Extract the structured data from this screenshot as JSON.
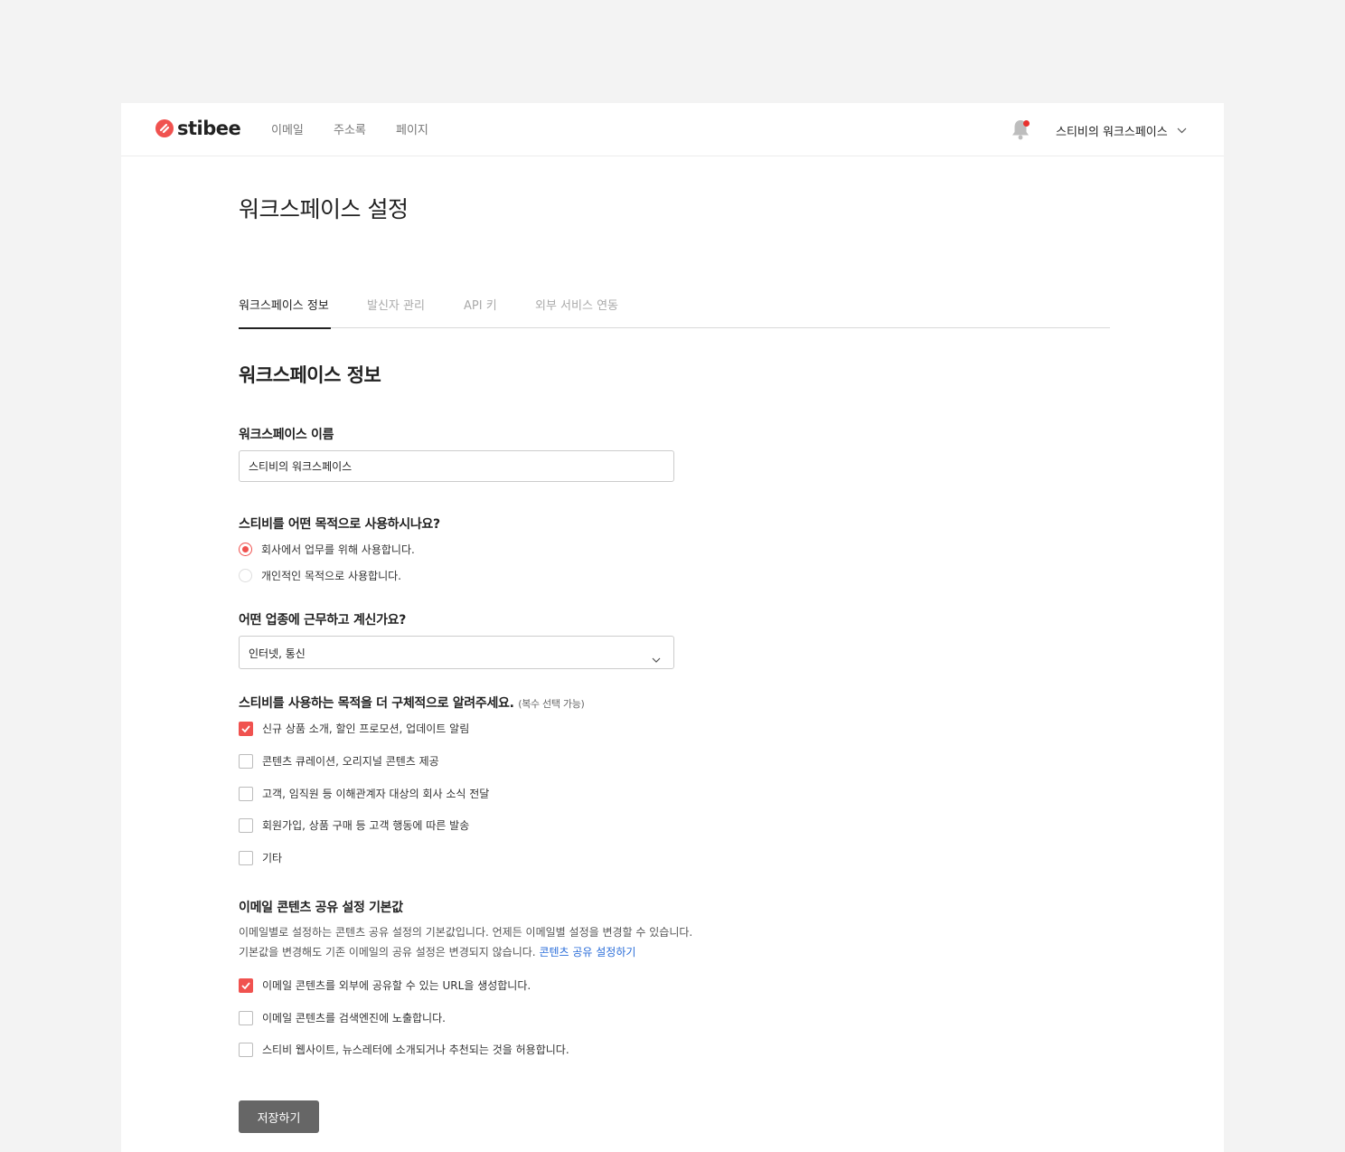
{
  "brand": {
    "name": "stibee",
    "accent": "#f0524f"
  },
  "nav": {
    "items": [
      {
        "label": "이메일"
      },
      {
        "label": "주소록"
      },
      {
        "label": "페이지"
      }
    ]
  },
  "workspace_menu": {
    "label": "스티비의 워크스페이스"
  },
  "page": {
    "title": "워크스페이스 설정"
  },
  "tabs": [
    {
      "label": "워크스페이스 정보",
      "active": true
    },
    {
      "label": "발신자 관리",
      "active": false
    },
    {
      "label": "API 키",
      "active": false
    },
    {
      "label": "외부 서비스 연동",
      "active": false
    }
  ],
  "section": {
    "title": "워크스페이스 정보"
  },
  "name_field": {
    "label": "워크스페이스 이름",
    "value": "스티비의 워크스페이스"
  },
  "purpose": {
    "label": "스티비를 어떤 목적으로 사용하시나요?",
    "options": [
      {
        "label": "회사에서 업무를 위해 사용합니다.",
        "selected": true
      },
      {
        "label": "개인적인 목적으로 사용합니다.",
        "selected": false
      }
    ]
  },
  "industry": {
    "label": "어떤 업종에 근무하고 계신가요?",
    "value": "인터넷, 통신"
  },
  "detail_purpose": {
    "label": "스티비를 사용하는 목적을 더 구체적으로 알려주세요.",
    "hint": "(복수 선택 가능)",
    "options": [
      {
        "label": "신규 상품 소개, 할인 프로모션, 업데이트 알림",
        "checked": true
      },
      {
        "label": "콘텐츠 큐레이션, 오리지널 콘텐츠 제공",
        "checked": false
      },
      {
        "label": "고객, 임직원 등 이해관계자 대상의 회사 소식 전달",
        "checked": false
      },
      {
        "label": "회원가입, 상품 구매 등 고객 행동에 따른 발송",
        "checked": false
      },
      {
        "label": "기타",
        "checked": false
      }
    ]
  },
  "sharing": {
    "label": "이메일 콘텐츠 공유 설정 기본값",
    "desc_line1": "이메일별로 설정하는 콘텐츠 공유 설정의 기본값입니다. 언제든 이메일별 설정을 변경할 수 있습니다.",
    "desc_line2": "기본값을 변경해도 기존 이메일의 공유 설정은 변경되지 않습니다.",
    "link_label": "콘텐츠 공유 설정하기",
    "options": [
      {
        "label": "이메일 콘텐츠를 외부에 공유할 수 있는 URL을 생성합니다.",
        "checked": true
      },
      {
        "label": "이메일 콘텐츠를 검색엔진에 노출합니다.",
        "checked": false
      },
      {
        "label": "스티비 웹사이트, 뉴스레터에 소개되거나 추천되는 것을 허용합니다.",
        "checked": false
      }
    ]
  },
  "save_button": {
    "label": "저장하기"
  }
}
